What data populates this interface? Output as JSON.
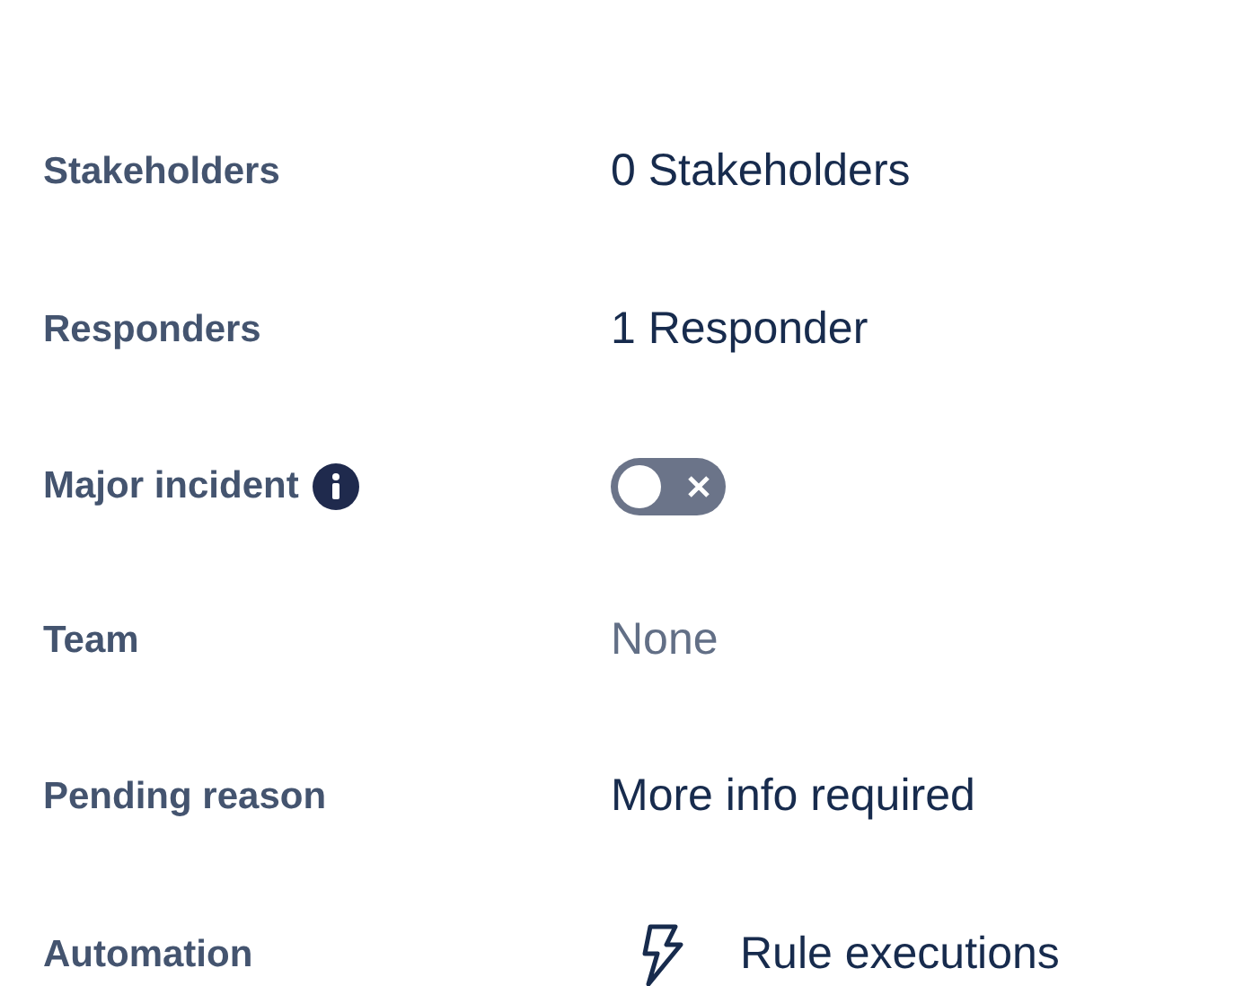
{
  "fields": [
    {
      "label": "Stakeholders",
      "kind": "text",
      "value": "0 Stakeholders"
    },
    {
      "label": "Responders",
      "kind": "text",
      "value": "1 Responder"
    },
    {
      "label": "Major incident",
      "kind": "toggle",
      "info": true,
      "on": false
    },
    {
      "label": "Team",
      "kind": "empty",
      "value": "None"
    },
    {
      "label": "Pending reason",
      "kind": "text",
      "value": "More info required"
    },
    {
      "label": "Automation",
      "kind": "action",
      "value": "Rule executions"
    }
  ]
}
